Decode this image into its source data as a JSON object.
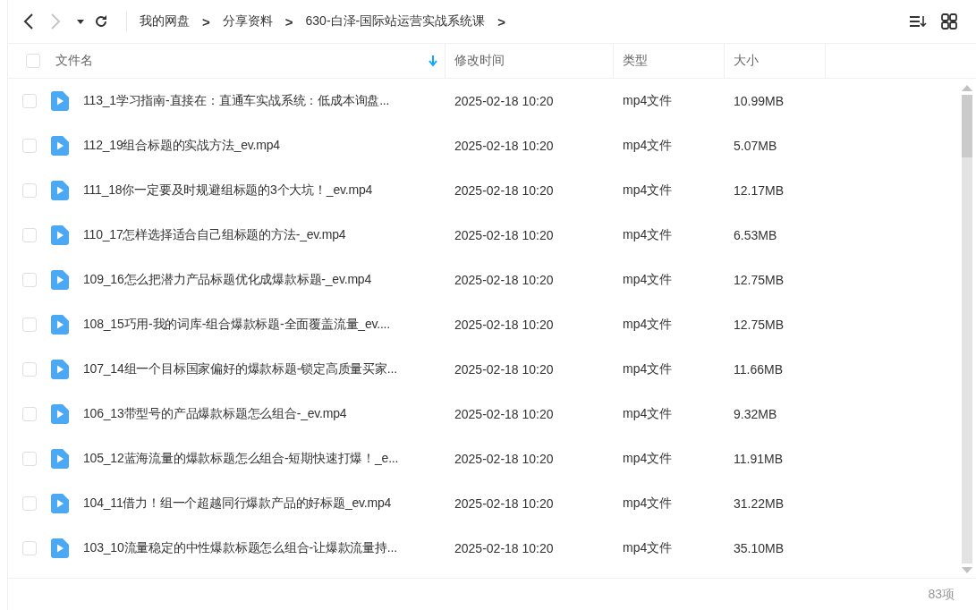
{
  "toolbar": {
    "breadcrumbs": [
      {
        "label": "我的网盘",
        "separator": ">"
      },
      {
        "label": "分享资料",
        "separator": ">"
      },
      {
        "label": "630-白泽-国际站运营实战系统课",
        "separator": ">"
      }
    ]
  },
  "table": {
    "columns": [
      {
        "label": "文件名",
        "sorted": true
      },
      {
        "label": "修改时间",
        "sorted": false
      },
      {
        "label": "类型",
        "sorted": false
      },
      {
        "label": "大小",
        "sorted": false
      }
    ],
    "select_all": {
      "checked": false
    },
    "rows": [
      {
        "name": "113_1学习指南-直接在：直通车实战系统：低成本询盘...",
        "modified": "2025-02-18 10:20",
        "type": "mp4文件",
        "size": "10.99MB",
        "checked": false
      },
      {
        "name": "112_19组合标题的实战方法_ev.mp4",
        "modified": "2025-02-18 10:20",
        "type": "mp4文件",
        "size": "5.07MB",
        "checked": false
      },
      {
        "name": "111_18你一定要及时规避组标题的3个大坑！_ev.mp4",
        "modified": "2025-02-18 10:20",
        "type": "mp4文件",
        "size": "12.17MB",
        "checked": false
      },
      {
        "name": "110_17怎样选择适合自己组标题的方法-_ev.mp4",
        "modified": "2025-02-18 10:20",
        "type": "mp4文件",
        "size": "6.53MB",
        "checked": false
      },
      {
        "name": "109_16怎么把潜力产品标题优化成爆款标题-_ev.mp4",
        "modified": "2025-02-18 10:20",
        "type": "mp4文件",
        "size": "12.75MB",
        "checked": false
      },
      {
        "name": "108_15巧用-我的词库-组合爆款标题-全面覆盖流量_ev....",
        "modified": "2025-02-18 10:20",
        "type": "mp4文件",
        "size": "12.75MB",
        "checked": false
      },
      {
        "name": "107_14组一个目标国家偏好的爆款标题-锁定高质量买家...",
        "modified": "2025-02-18 10:20",
        "type": "mp4文件",
        "size": "11.66MB",
        "checked": false
      },
      {
        "name": "106_13带型号的产品爆款标题怎么组合-_ev.mp4",
        "modified": "2025-02-18 10:20",
        "type": "mp4文件",
        "size": "9.32MB",
        "checked": false
      },
      {
        "name": "105_12蓝海流量的爆款标题怎么组合-短期快速打爆！_e...",
        "modified": "2025-02-18 10:20",
        "type": "mp4文件",
        "size": "11.91MB",
        "checked": false
      },
      {
        "name": "104_11借力！组一个超越同行爆款产品的好标题_ev.mp4",
        "modified": "2025-02-18 10:20",
        "type": "mp4文件",
        "size": "31.22MB",
        "checked": false
      },
      {
        "name": "103_10流量稳定的中性爆款标题怎么组合-让爆款流量持...",
        "modified": "2025-02-18 10:20",
        "type": "mp4文件",
        "size": "35.10MB",
        "checked": false
      }
    ]
  },
  "status_bar": {
    "count": "83项"
  }
}
